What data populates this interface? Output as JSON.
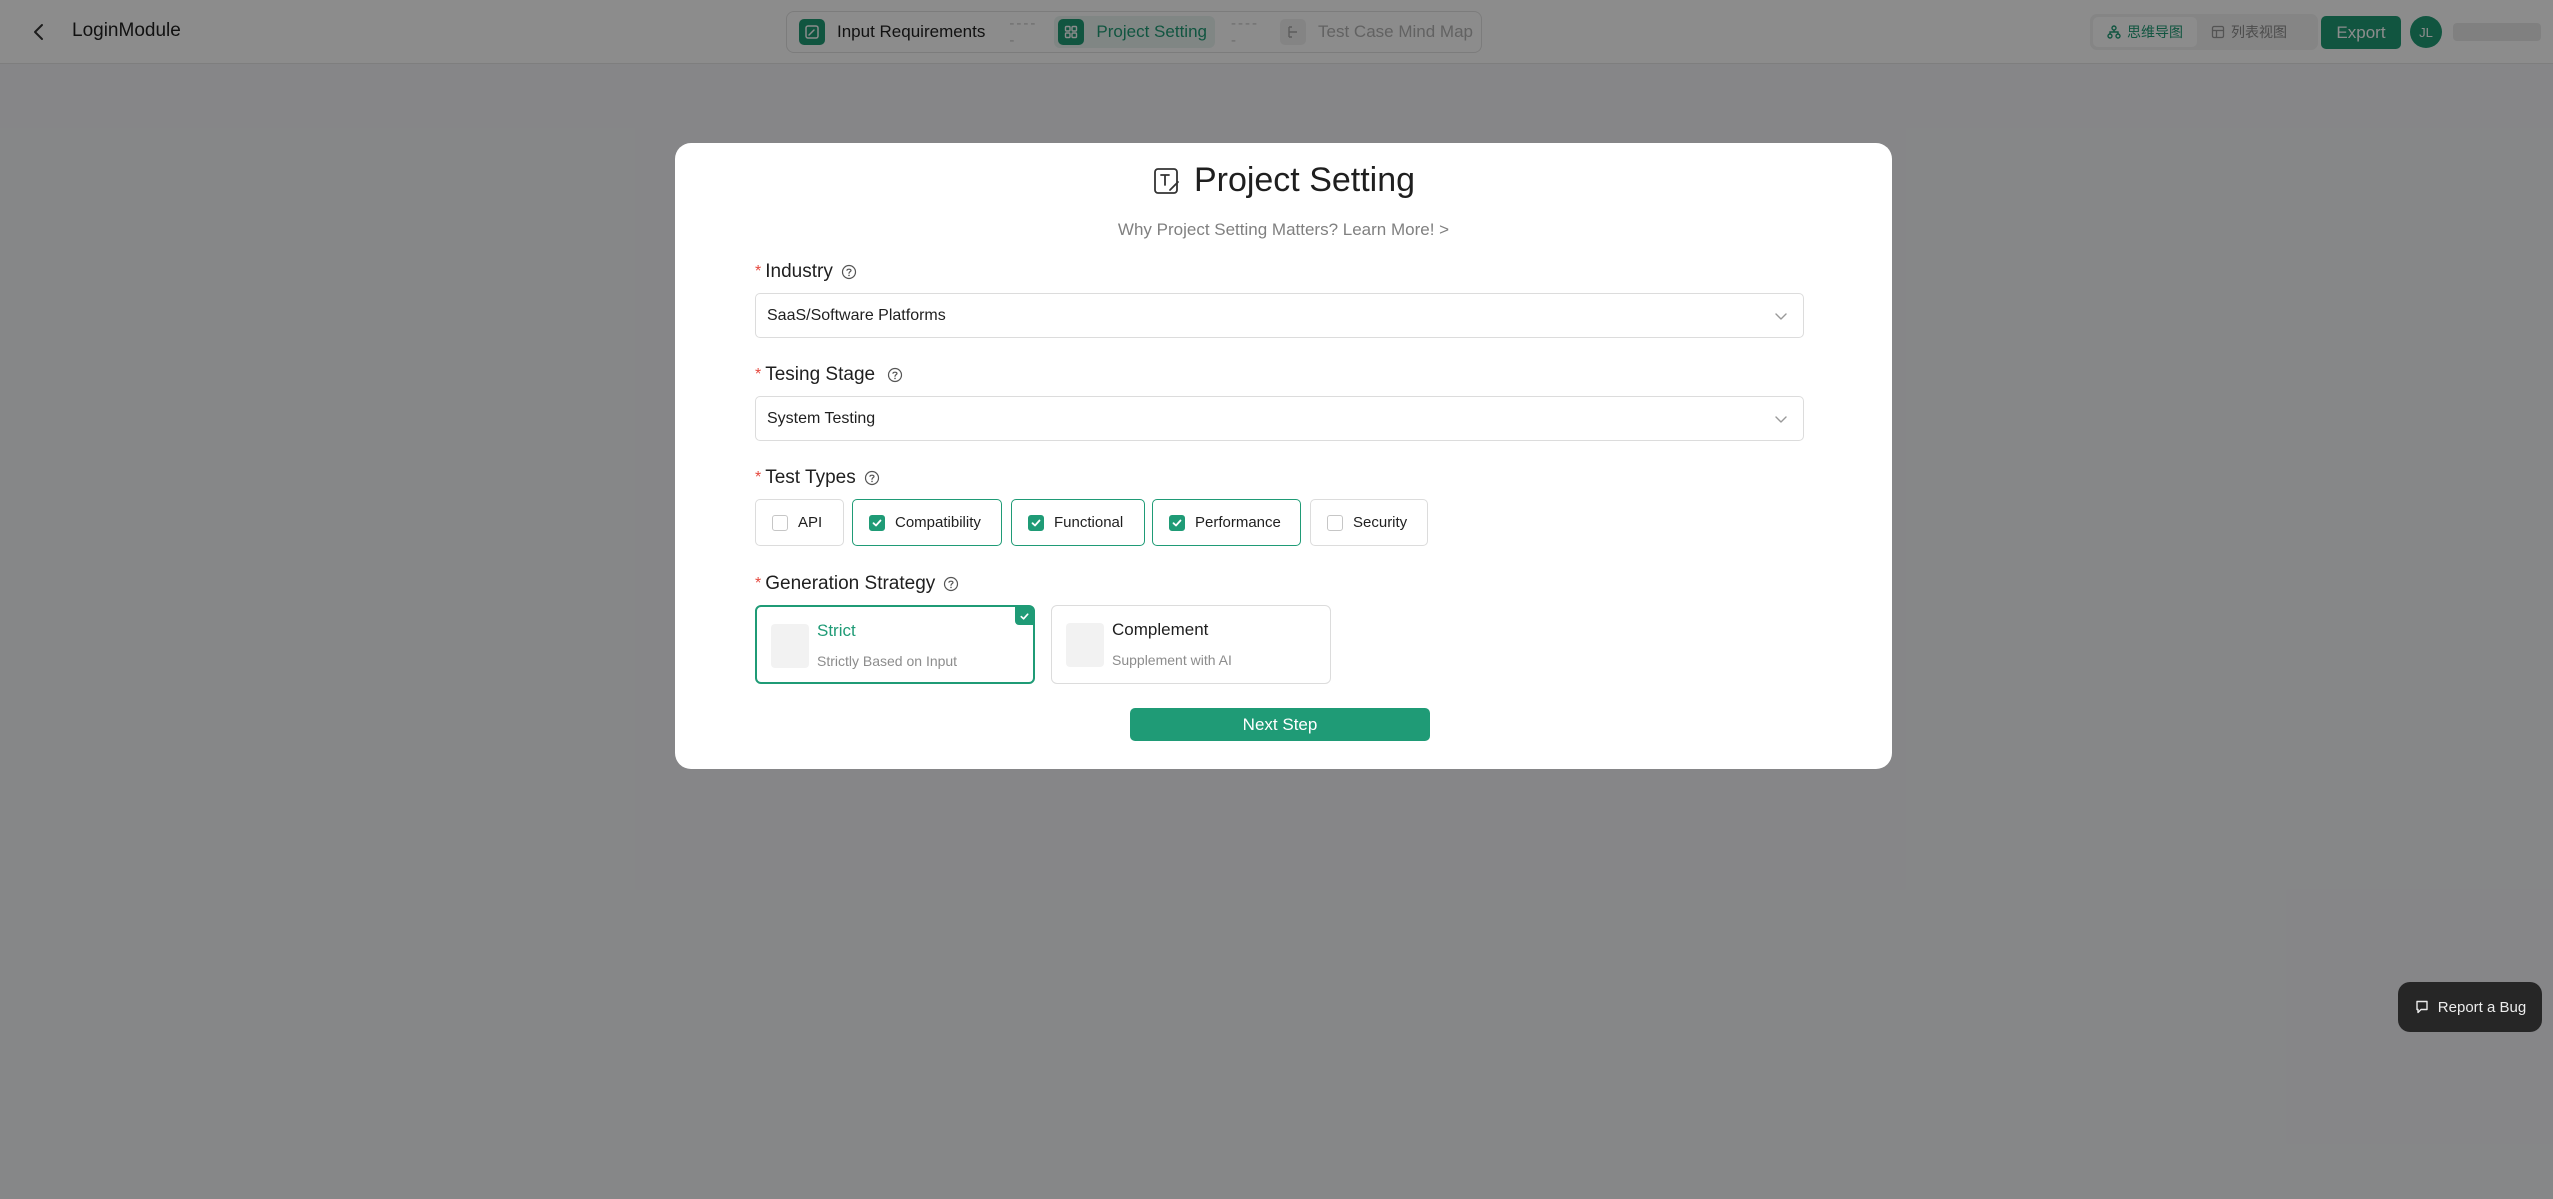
{
  "header": {
    "title": "LoginModule",
    "steps": [
      {
        "label": "Input Requirements",
        "state": "done"
      },
      {
        "label": "Project Setting",
        "state": "active"
      },
      {
        "label": "Test Case Mind Map",
        "state": "disabled"
      }
    ],
    "step_separator": "-----",
    "view_toggle": [
      {
        "label": "思维导图",
        "icon": "mindmap-icon",
        "active": true
      },
      {
        "label": "列表视图",
        "icon": "table-icon",
        "active": false
      }
    ],
    "export_label": "Export",
    "avatar_initials": "JL"
  },
  "modal": {
    "title": "Project Setting",
    "learn_more": "Why Project Setting Matters? Learn More!  >",
    "industry": {
      "label": "Industry",
      "value": "SaaS/Software Platforms"
    },
    "testing_stage": {
      "label": "Tesing Stage",
      "value": "System Testing"
    },
    "test_types": {
      "label": "Test Types",
      "options": [
        {
          "label": "API",
          "checked": false
        },
        {
          "label": "Compatibility",
          "checked": true
        },
        {
          "label": "Functional",
          "checked": true
        },
        {
          "label": "Performance",
          "checked": true
        },
        {
          "label": "Security",
          "checked": false
        }
      ]
    },
    "generation_strategy": {
      "label": "Generation Strategy",
      "options": [
        {
          "title": "Strict",
          "desc": "Strictly Based on Input",
          "selected": true
        },
        {
          "title": "Complement",
          "desc": "Supplement with AI",
          "selected": false
        }
      ]
    },
    "next_label": "Next Step"
  },
  "report_bug_label": "Report a Bug",
  "colors": {
    "accent": "#1f9b76",
    "required": "#e5483e",
    "overlay": "rgba(0,0,0,0.45)"
  }
}
